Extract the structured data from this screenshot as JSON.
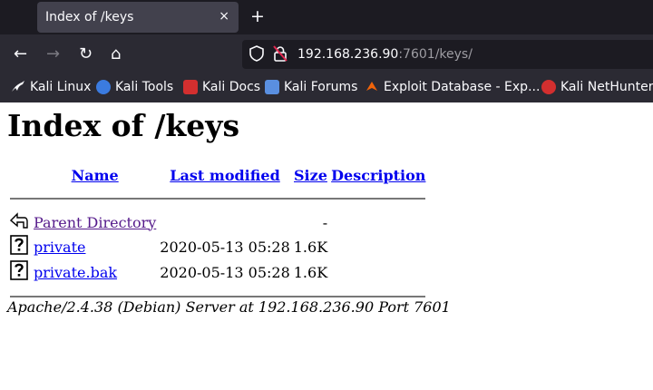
{
  "browser": {
    "tab": {
      "title": "Index of /keys",
      "close": "×"
    },
    "new_tab": "+",
    "nav": {
      "back": "←",
      "forward": "→",
      "reload": "↻",
      "home": "⌂"
    },
    "url": {
      "host": "192.168.236.90",
      "rest": ":7601/keys/"
    },
    "bookmarks": [
      {
        "label": "Kali Linux",
        "icon": "kali-dragon-icon",
        "color": "#ffffff"
      },
      {
        "label": "Kali Tools",
        "icon": "kali-tools-icon",
        "color": "#3b7be0"
      },
      {
        "label": "Kali Docs",
        "icon": "kali-docs-icon",
        "color": "#d32f2f"
      },
      {
        "label": "Kali Forums",
        "icon": "kali-forums-icon",
        "color": "#5a8fe0"
      },
      {
        "label": "Exploit Database - Exp...",
        "icon": "exploit-db-icon",
        "color": "#f0640a"
      },
      {
        "label": "Kali NetHunter",
        "icon": "nethunter-icon",
        "color": "#d32f2f"
      }
    ]
  },
  "page": {
    "title": "Index of /keys",
    "columns": {
      "name": "Name",
      "modified": "Last modified",
      "size": "Size",
      "description": "Description"
    },
    "parent": {
      "name": "Parent Directory",
      "size": "-"
    },
    "files": [
      {
        "name": "private",
        "modified": "2020-05-13 05:28",
        "size": "1.6K"
      },
      {
        "name": "private.bak",
        "modified": "2020-05-13 05:28",
        "size": "1.6K"
      }
    ],
    "footer": "Apache/2.4.38 (Debian) Server at 192.168.236.90 Port 7601"
  }
}
